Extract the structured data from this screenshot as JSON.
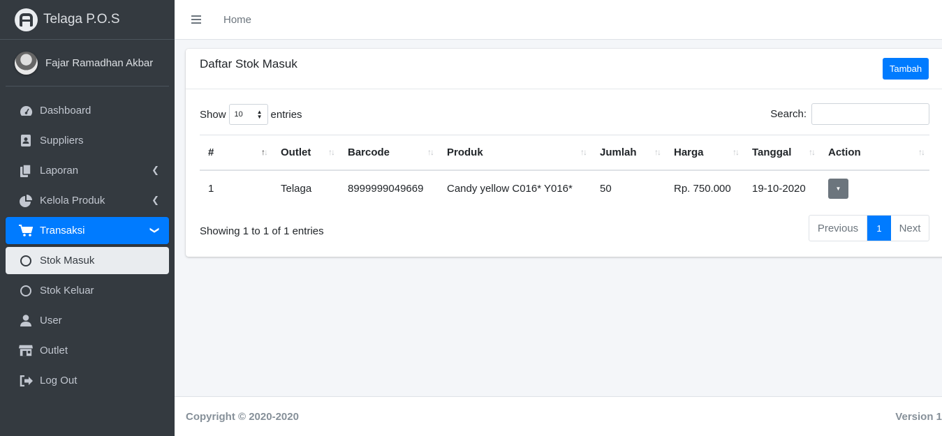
{
  "app": {
    "brand": "Telaga P.O.S"
  },
  "user": {
    "name": "Fajar Ramadhan Akbar"
  },
  "sidebar": {
    "items": [
      {
        "label": "Dashboard",
        "icon": "tachometer-icon"
      },
      {
        "label": "Suppliers",
        "icon": "address-book-icon"
      },
      {
        "label": "Laporan",
        "icon": "copy-icon"
      },
      {
        "label": "Kelola Produk",
        "icon": "pie-chart-icon"
      },
      {
        "label": "Transaksi",
        "icon": "cart-icon"
      },
      {
        "label": "Stok Masuk",
        "icon": "circle-icon"
      },
      {
        "label": "Stok Keluar",
        "icon": "circle-icon"
      },
      {
        "label": "User",
        "icon": "user-icon"
      },
      {
        "label": "Outlet",
        "icon": "store-icon"
      },
      {
        "label": "Log Out",
        "icon": "sign-out-icon"
      }
    ]
  },
  "header": {
    "home": "Home"
  },
  "card": {
    "title": "Daftar Stok Masuk",
    "add_button": "Tambah",
    "show_label": "Show",
    "entries_value": "10",
    "entries_label": "entries",
    "search_label": "Search:",
    "columns": [
      "#",
      "Outlet",
      "Barcode",
      "Produk",
      "Jumlah",
      "Harga",
      "Tanggal",
      "Action"
    ],
    "rows": [
      {
        "no": "1",
        "outlet": "Telaga",
        "barcode": "8999999049669",
        "produk": "Candy yellow C016* Y016*",
        "jumlah": "50",
        "harga": "Rp. 750.000",
        "tanggal": "19-10-2020"
      }
    ],
    "info": "Showing 1 to 1 of 1 entries",
    "pagination": {
      "previous": "Previous",
      "page": "1",
      "next": "Next"
    }
  },
  "footer": {
    "copyright": "Copyright © 2020-2020",
    "version": "Version 1"
  },
  "colors": {
    "primary": "#007bff",
    "sidebar": "#343a40",
    "secondary": "#6c757d"
  }
}
